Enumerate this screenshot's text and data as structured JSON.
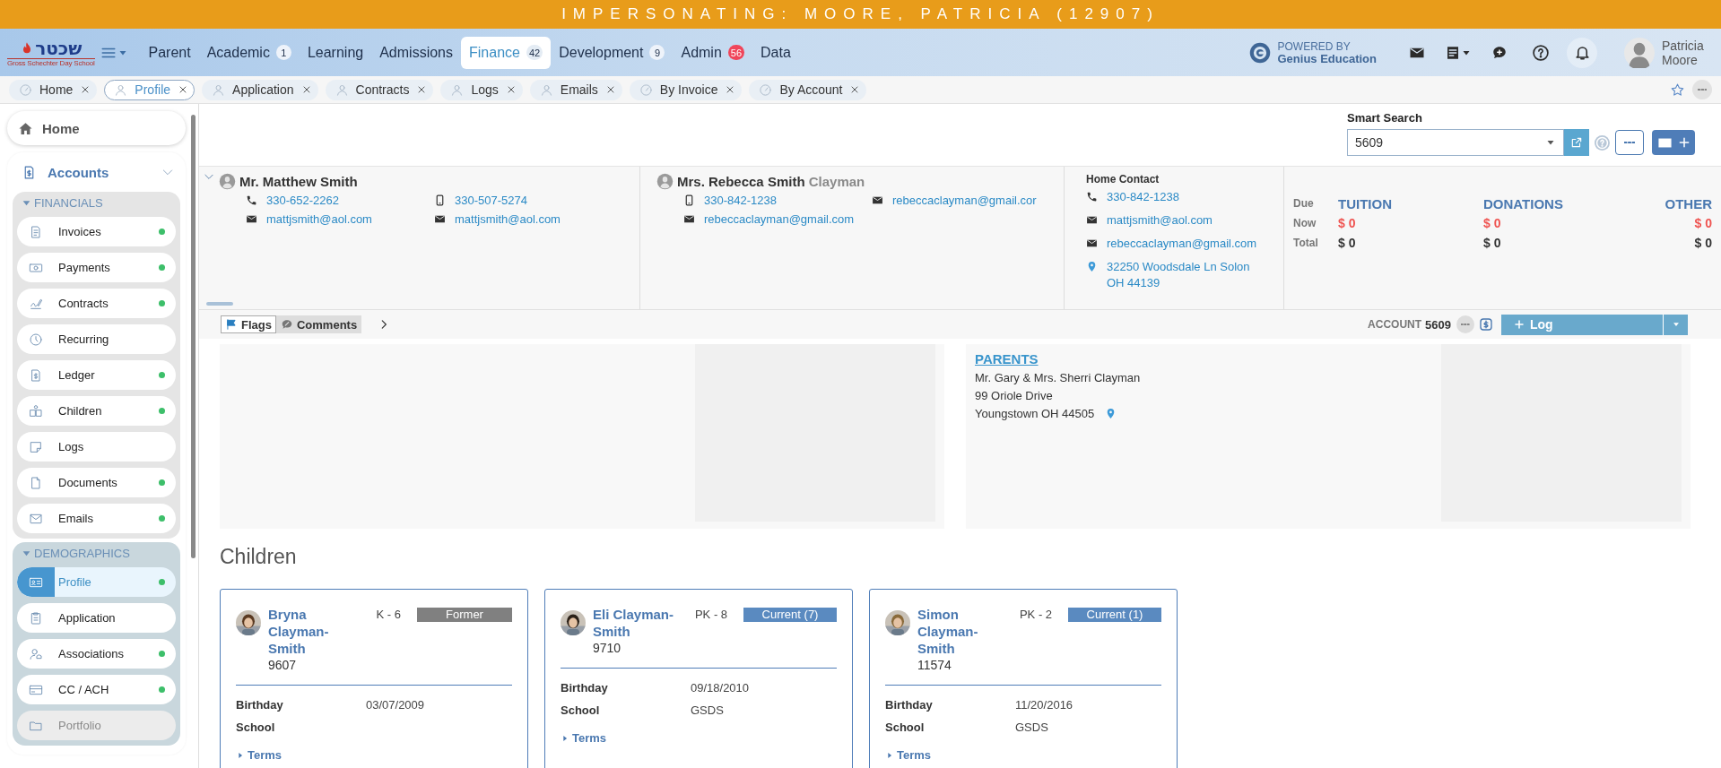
{
  "banner": {
    "text": "IMPERSONATING: MOORE, PATRICIA (12907)"
  },
  "nav": {
    "logo": {
      "title": "שכטר",
      "subtitle": "Gross Schechter Day School"
    },
    "items": [
      {
        "label": "Parent",
        "selected": false
      },
      {
        "label": "Academic",
        "selected": false,
        "badge": {
          "count": "1",
          "alert": false
        }
      },
      {
        "label": "Learning",
        "selected": false
      },
      {
        "label": "Admissions",
        "selected": false
      },
      {
        "label": "Finance",
        "selected": true,
        "badge": {
          "count": "42",
          "alert": false
        }
      },
      {
        "label": "Development",
        "selected": false,
        "badge": {
          "count": "9",
          "alert": false
        }
      },
      {
        "label": "Admin",
        "selected": false,
        "badge": {
          "count": "56",
          "alert": true
        }
      },
      {
        "label": "Data",
        "selected": false
      }
    ],
    "powered_by": [
      "POWERED BY",
      "Genius Education"
    ],
    "user": {
      "name": "Patricia Moore"
    }
  },
  "tabs": [
    {
      "label": "Home",
      "kind": "report",
      "selected": false
    },
    {
      "label": "Profile",
      "kind": "person",
      "selected": true
    },
    {
      "label": "Application",
      "kind": "person",
      "selected": false
    },
    {
      "label": "Contracts",
      "kind": "person",
      "selected": false
    },
    {
      "label": "Logs",
      "kind": "person",
      "selected": false
    },
    {
      "label": "Emails",
      "kind": "person",
      "selected": false
    },
    {
      "label": "By Invoice",
      "kind": "report",
      "selected": false
    },
    {
      "label": "By Account",
      "kind": "report",
      "selected": false
    }
  ],
  "sidebar": {
    "home": "Home",
    "accounts": {
      "label": "Accounts",
      "expanded": true
    },
    "groups": [
      {
        "title": "FINANCIALS",
        "expanded": true,
        "items": [
          {
            "label": "Invoices",
            "dot": true,
            "selected": false,
            "disabled": false
          },
          {
            "label": "Payments",
            "dot": true,
            "selected": false,
            "disabled": false
          },
          {
            "label": "Contracts",
            "dot": true,
            "selected": false,
            "disabled": false
          },
          {
            "label": "Recurring",
            "dot": false,
            "selected": false,
            "disabled": false
          },
          {
            "label": "Ledger",
            "dot": true,
            "selected": false,
            "disabled": false
          },
          {
            "label": "Children",
            "dot": true,
            "selected": false,
            "disabled": false
          },
          {
            "label": "Logs",
            "dot": false,
            "selected": false,
            "disabled": false
          },
          {
            "label": "Documents",
            "dot": true,
            "selected": false,
            "disabled": false
          },
          {
            "label": "Emails",
            "dot": true,
            "selected": false,
            "disabled": false
          }
        ]
      },
      {
        "title": "DEMOGRAPHICS",
        "expanded": true,
        "items": [
          {
            "label": "Profile",
            "dot": true,
            "selected": true,
            "disabled": false
          },
          {
            "label": "Application",
            "dot": false,
            "selected": false,
            "disabled": false
          },
          {
            "label": "Associations",
            "dot": true,
            "selected": false,
            "disabled": false
          },
          {
            "label": "CC / ACH",
            "dot": true,
            "selected": false,
            "disabled": false
          },
          {
            "label": "Portfolio",
            "dot": false,
            "selected": false,
            "disabled": true
          }
        ]
      }
    ]
  },
  "smart_search": {
    "label": "Smart Search",
    "value": "5609"
  },
  "contacts": [
    {
      "name": "Mr. Matthew Smith",
      "items": [
        {
          "kind": "phone",
          "text": "330-652-2262"
        },
        {
          "kind": "mobile",
          "text": "330-507-5274"
        },
        {
          "kind": "email",
          "text": "mattjsmith@aol.com"
        },
        {
          "kind": "email",
          "text": "mattjsmith@aol.com"
        }
      ]
    },
    {
      "name": "Mrs. Rebecca Smith",
      "name_suffix": "Clayman",
      "items": [
        {
          "kind": "mobile",
          "text": "330-842-1238"
        },
        {
          "kind": "email",
          "text": "rebeccaclayman@gmail.cor"
        },
        {
          "kind": "email",
          "text": "rebeccaclayman@gmail.com"
        }
      ]
    }
  ],
  "home_contact": {
    "title": "Home Contact",
    "items": [
      {
        "kind": "phone",
        "text": "330-842-1238"
      },
      {
        "kind": "email",
        "text": "mattjsmith@aol.com"
      },
      {
        "kind": "email",
        "text": "rebeccaclayman@gmail.com"
      },
      {
        "kind": "address",
        "text": "32250 Woodsdale Ln Solon OH 44139"
      }
    ]
  },
  "balances": {
    "row_labels": [
      "Due",
      "Now",
      "Total"
    ],
    "columns": [
      {
        "title": "TUITION",
        "now": "$ 0",
        "total": "$ 0"
      },
      {
        "title": "DONATIONS",
        "now": "$ 0",
        "total": "$ 0"
      },
      {
        "title": "OTHER",
        "now": "$ 0",
        "total": "$ 0"
      }
    ]
  },
  "toolbar": {
    "tabs": [
      {
        "label": "Flags",
        "kind": "flag",
        "selected": true
      },
      {
        "label": "Comments",
        "kind": "comment",
        "selected": false
      }
    ],
    "account_label": "ACCOUNT",
    "account_number": "5609",
    "log_button": "Log"
  },
  "panels": [
    {
      "kind": "blank"
    },
    {
      "kind": "address",
      "heading": "PARENTS",
      "lines": [
        "Mr. Gary & Mrs. Sherri Clayman",
        "99 Oriole Drive",
        "Youngstown OH 44505"
      ]
    }
  ],
  "children": {
    "heading": "Children",
    "cards": [
      {
        "name": "Bryna Clayman-Smith",
        "grade": "K - 6",
        "status": "Former",
        "kind": "former",
        "id": "9607",
        "fields": [
          {
            "label": "Birthday",
            "value": "03/07/2009"
          },
          {
            "label": "School"
          }
        ],
        "link": "Terms"
      },
      {
        "name": "Eli Clayman-Smith",
        "grade": "PK - 8",
        "status": "Current (7)",
        "kind": "current",
        "id": "9710",
        "fields": [
          {
            "label": "Birthday",
            "value": "09/18/2010"
          },
          {
            "label": "School",
            "value": "GSDS"
          }
        ],
        "link": "Terms"
      },
      {
        "name": "Simon Clayman-Smith",
        "grade": "PK - 2",
        "status": "Current (1)",
        "kind": "current",
        "id": "11574",
        "fields": [
          {
            "label": "Birthday",
            "value": "11/20/2016"
          },
          {
            "label": "School",
            "value": "GSDS"
          }
        ],
        "link": "Terms"
      }
    ]
  }
}
